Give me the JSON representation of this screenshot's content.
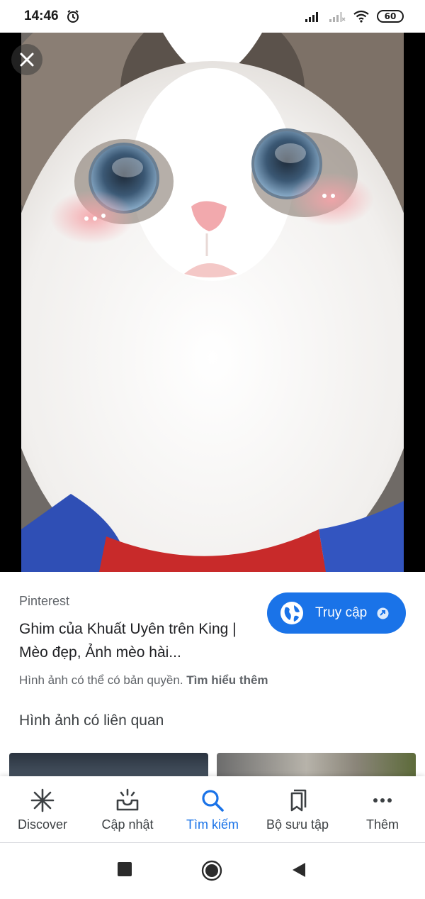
{
  "status_bar": {
    "time": "14:46",
    "battery": "60",
    "icons": [
      "alarm-icon",
      "signal-icon",
      "signal-weak-icon",
      "wifi-icon",
      "battery-icon"
    ]
  },
  "viewer": {
    "close_icon": "close-icon",
    "image_alt": "cat-photo"
  },
  "result": {
    "source": "Pinterest",
    "title": "Ghim của Khuất Uyên trên King | Mèo đẹp, Ảnh mèo hài...",
    "visit_label": "Truy cập",
    "copyright_text": "Hình ảnh có thể có bản quyền.",
    "learn_more": "Tìm hiểu thêm",
    "related_heading": "Hình ảnh có liên quan"
  },
  "bottom_nav": {
    "items": [
      {
        "label": "Discover",
        "icon": "asterisk-icon"
      },
      {
        "label": "Cập nhật",
        "icon": "inbox-icon"
      },
      {
        "label": "Tìm kiếm",
        "icon": "search-icon"
      },
      {
        "label": "Bộ sưu tập",
        "icon": "collections-icon"
      },
      {
        "label": "Thêm",
        "icon": "more-icon"
      }
    ],
    "active_index": 2,
    "colors": {
      "active": "#1a73e8",
      "inactive": "#3c4043"
    }
  },
  "system_nav": {
    "icons": [
      "recents-icon",
      "home-icon",
      "back-icon"
    ]
  }
}
